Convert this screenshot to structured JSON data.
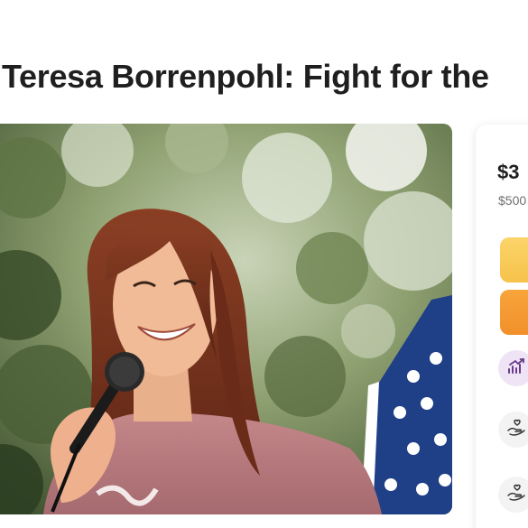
{
  "campaign": {
    "title": "Teresa Borrenpohl: Fight for the"
  },
  "hero": {
    "image_alt": "Woman with long auburn hair smiling while speaking into a microphone, American flag in background"
  },
  "donation_card": {
    "raised": "$3",
    "goal": "$500",
    "share_label": "",
    "donate_label": ""
  },
  "icons": {
    "trending": "trending-up-icon",
    "donor_1": "donor-hand-heart-icon",
    "donor_2": "donor-hand-heart-icon"
  },
  "colors": {
    "share_button": "#f6c24a",
    "donate_button": "#f2902a",
    "trending_badge": "#efe4f5",
    "trending_icon": "#6b3a8c"
  }
}
